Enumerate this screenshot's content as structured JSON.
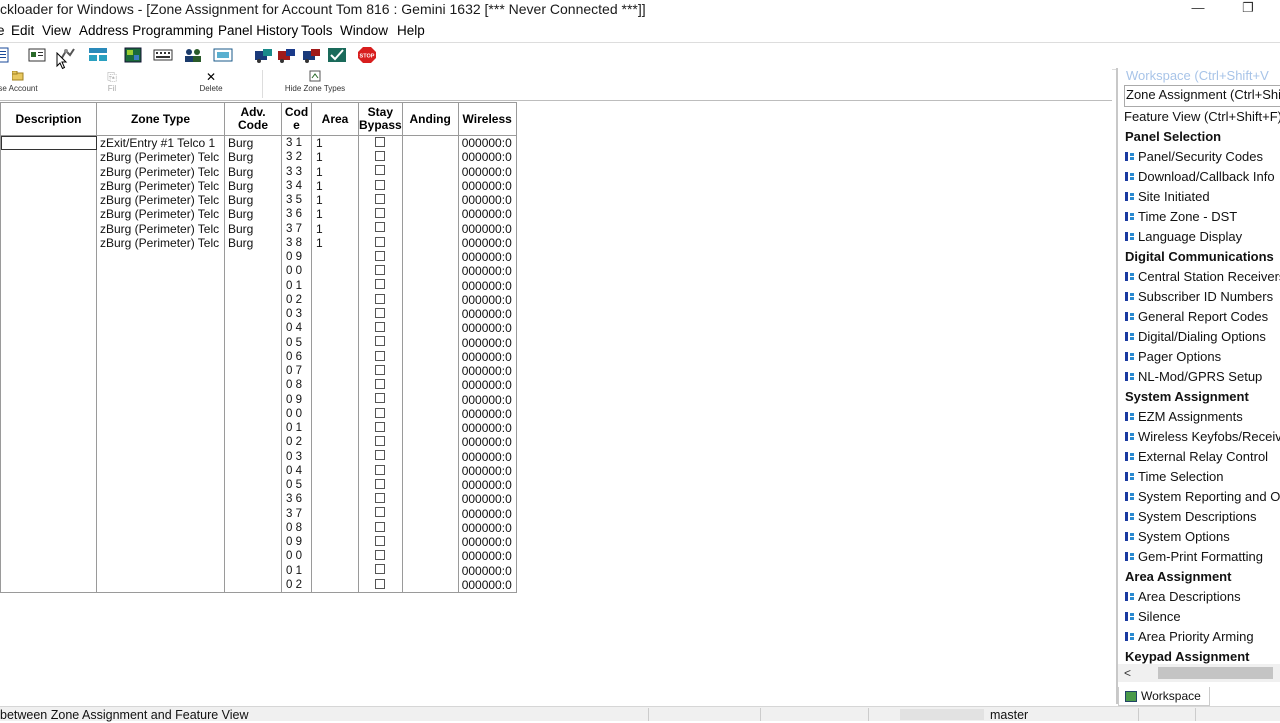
{
  "window": {
    "title": "ckloader for Windows - [Zone Assignment for Account Tom 816 : Gemini 1632 [*** Never Connected ***]]",
    "minimize": "—",
    "restore": "❐"
  },
  "menu": [
    "e",
    "Edit",
    "View",
    "Address Programming",
    "Panel History",
    "Tools",
    "Window",
    "Help"
  ],
  "toolbar2": {
    "close_account": "se Account",
    "fill": "Fil",
    "delete": "Delete",
    "hide_zone_types": "Hide Zone Types"
  },
  "grid": {
    "headers": {
      "description": "Description",
      "zone_type": "Zone Type",
      "adv_code": "Adv. Code",
      "code": "Cod e",
      "area": "Area",
      "stay_bypass": "Stay Bypass",
      "anding": "Anding",
      "wireless": "Wireless"
    },
    "rows": [
      {
        "zone_type": "zExit/Entry #1 Telco 1",
        "adv": "Burg",
        "code": "3 1",
        "area": "1",
        "wireless": "000000:0"
      },
      {
        "zone_type": "zBurg (Perimeter) Telc",
        "adv": "Burg",
        "code": "3 2",
        "area": "1",
        "wireless": "000000:0"
      },
      {
        "zone_type": "zBurg (Perimeter) Telc",
        "adv": "Burg",
        "code": "3 3",
        "area": "1",
        "wireless": "000000:0"
      },
      {
        "zone_type": "zBurg (Perimeter) Telc",
        "adv": "Burg",
        "code": "3 4",
        "area": "1",
        "wireless": "000000:0"
      },
      {
        "zone_type": "zBurg (Perimeter) Telc",
        "adv": "Burg",
        "code": "3 5",
        "area": "1",
        "wireless": "000000:0"
      },
      {
        "zone_type": "zBurg (Perimeter) Telc",
        "adv": "Burg",
        "code": "3 6",
        "area": "1",
        "wireless": "000000:0"
      },
      {
        "zone_type": "zBurg (Perimeter) Telc",
        "adv": "Burg",
        "code": "3 7",
        "area": "1",
        "wireless": "000000:0"
      },
      {
        "zone_type": "zBurg (Perimeter) Telc",
        "adv": "Burg",
        "code": "3 8",
        "area": "1",
        "wireless": "000000:0"
      },
      {
        "zone_type": "",
        "adv": "",
        "code": "0 9",
        "area": "",
        "wireless": "000000:0"
      },
      {
        "zone_type": "",
        "adv": "",
        "code": "0 0",
        "area": "",
        "wireless": "000000:0"
      },
      {
        "zone_type": "",
        "adv": "",
        "code": "0 1",
        "area": "",
        "wireless": "000000:0"
      },
      {
        "zone_type": "",
        "adv": "",
        "code": "0 2",
        "area": "",
        "wireless": "000000:0"
      },
      {
        "zone_type": "",
        "adv": "",
        "code": "0 3",
        "area": "",
        "wireless": "000000:0"
      },
      {
        "zone_type": "",
        "adv": "",
        "code": "0 4",
        "area": "",
        "wireless": "000000:0"
      },
      {
        "zone_type": "",
        "adv": "",
        "code": "0 5",
        "area": "",
        "wireless": "000000:0"
      },
      {
        "zone_type": "",
        "adv": "",
        "code": "0 6",
        "area": "",
        "wireless": "000000:0"
      },
      {
        "zone_type": "",
        "adv": "",
        "code": "0 7",
        "area": "",
        "wireless": "000000:0"
      },
      {
        "zone_type": "",
        "adv": "",
        "code": "0 8",
        "area": "",
        "wireless": "000000:0"
      },
      {
        "zone_type": "",
        "adv": "",
        "code": "0 9",
        "area": "",
        "wireless": "000000:0"
      },
      {
        "zone_type": "",
        "adv": "",
        "code": "0 0",
        "area": "",
        "wireless": "000000:0"
      },
      {
        "zone_type": "",
        "adv": "",
        "code": "0 1",
        "area": "",
        "wireless": "000000:0"
      },
      {
        "zone_type": "",
        "adv": "",
        "code": "0 2",
        "area": "",
        "wireless": "000000:0"
      },
      {
        "zone_type": "",
        "adv": "",
        "code": "0 3",
        "area": "",
        "wireless": "000000:0"
      },
      {
        "zone_type": "",
        "adv": "",
        "code": "0 4",
        "area": "",
        "wireless": "000000:0"
      },
      {
        "zone_type": "",
        "adv": "",
        "code": "0 5",
        "area": "",
        "wireless": "000000:0"
      },
      {
        "zone_type": "",
        "adv": "",
        "code": "3 6",
        "area": "",
        "wireless": "000000:0"
      },
      {
        "zone_type": "",
        "adv": "",
        "code": "3 7",
        "area": "",
        "wireless": "000000:0"
      },
      {
        "zone_type": "",
        "adv": "",
        "code": "0 8",
        "area": "",
        "wireless": "000000:0"
      },
      {
        "zone_type": "",
        "adv": "",
        "code": "0 9",
        "area": "",
        "wireless": "000000:0"
      },
      {
        "zone_type": "",
        "adv": "",
        "code": "0 0",
        "area": "",
        "wireless": "000000:0"
      },
      {
        "zone_type": "",
        "adv": "",
        "code": "0 1",
        "area": "",
        "wireless": "000000:0"
      },
      {
        "zone_type": "",
        "adv": "",
        "code": "0 2",
        "area": "",
        "wireless": "000000:0"
      }
    ]
  },
  "workspace": {
    "title": "Workspace (Ctrl+Shift+V",
    "items": [
      {
        "type": "first",
        "label": "Zone Assignment (Ctrl+Shift"
      },
      {
        "type": "plain",
        "label": "Feature View (Ctrl+Shift+F)"
      },
      {
        "type": "head",
        "label": "Panel Selection"
      },
      {
        "type": "sub",
        "label": "Panel/Security Codes"
      },
      {
        "type": "sub",
        "label": "Download/Callback Info"
      },
      {
        "type": "sub",
        "label": "Site Initiated"
      },
      {
        "type": "sub",
        "label": "Time Zone - DST"
      },
      {
        "type": "sub",
        "label": "Language Display"
      },
      {
        "type": "head",
        "label": "Digital Communications"
      },
      {
        "type": "sub",
        "label": "Central Station Receivers"
      },
      {
        "type": "sub",
        "label": "Subscriber ID Numbers"
      },
      {
        "type": "sub",
        "label": "General Report Codes"
      },
      {
        "type": "sub",
        "label": "Digital/Dialing Options"
      },
      {
        "type": "sub",
        "label": "Pager Options"
      },
      {
        "type": "sub",
        "label": "NL-Mod/GPRS Setup"
      },
      {
        "type": "head",
        "label": "System Assignment"
      },
      {
        "type": "sub",
        "label": "EZM Assignments"
      },
      {
        "type": "sub",
        "label": "Wireless Keyfobs/Receive"
      },
      {
        "type": "sub",
        "label": "External Relay Control"
      },
      {
        "type": "sub",
        "label": "Time Selection"
      },
      {
        "type": "sub",
        "label": "System Reporting and Ou"
      },
      {
        "type": "sub",
        "label": "System Descriptions"
      },
      {
        "type": "sub",
        "label": "System Options"
      },
      {
        "type": "sub",
        "label": "Gem-Print Formatting"
      },
      {
        "type": "head",
        "label": "Area Assignment"
      },
      {
        "type": "sub",
        "label": "Area Descriptions"
      },
      {
        "type": "sub",
        "label": "Silence"
      },
      {
        "type": "sub",
        "label": "Area Priority Arming"
      },
      {
        "type": "head",
        "label": "Keypad Assignment"
      }
    ],
    "tab_label": "Workspace",
    "scroll_left": "<"
  },
  "status": {
    "message": "between Zone Assignment and Feature View",
    "branch": "master"
  }
}
